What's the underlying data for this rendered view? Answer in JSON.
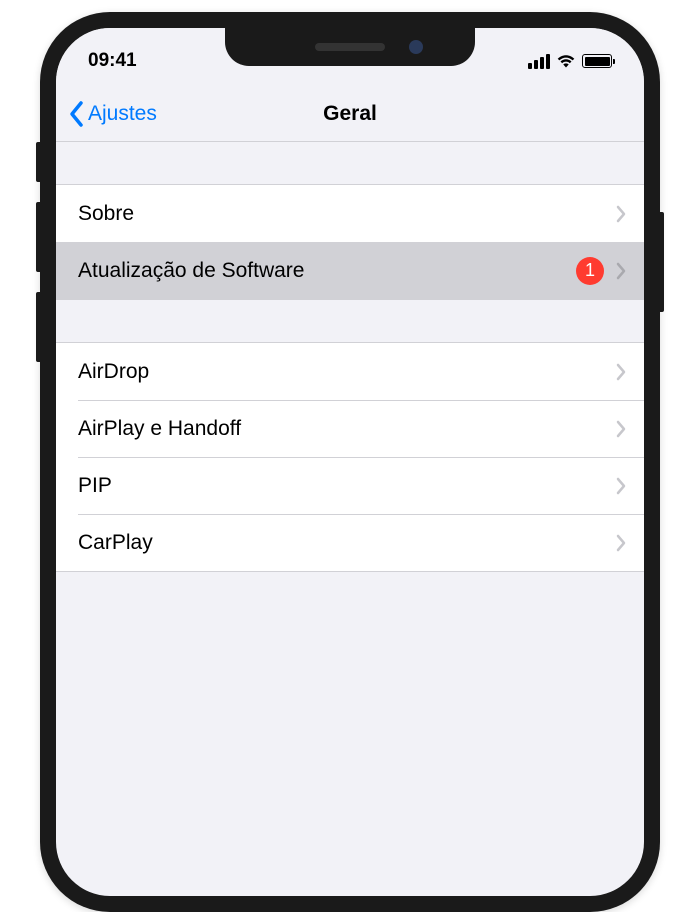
{
  "status_bar": {
    "time": "09:41"
  },
  "nav": {
    "back_label": "Ajustes",
    "title": "Geral"
  },
  "sections": [
    {
      "items": [
        {
          "label": "Sobre",
          "badge": null,
          "highlighted": false
        },
        {
          "label": "Atualização de Software",
          "badge": "1",
          "highlighted": true
        }
      ]
    },
    {
      "items": [
        {
          "label": "AirDrop",
          "badge": null,
          "highlighted": false
        },
        {
          "label": "AirPlay e Handoff",
          "badge": null,
          "highlighted": false
        },
        {
          "label": "PIP",
          "badge": null,
          "highlighted": false
        },
        {
          "label": "CarPlay",
          "badge": null,
          "highlighted": false
        }
      ]
    }
  ]
}
